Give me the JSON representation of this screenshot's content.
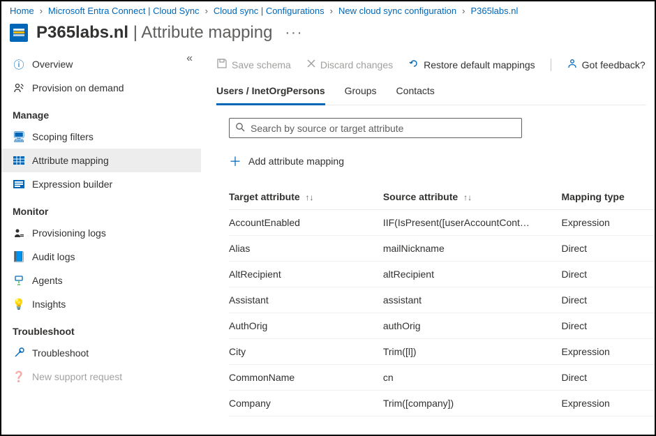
{
  "breadcrumb": [
    "Home",
    "Microsoft Entra Connect | Cloud Sync",
    "Cloud sync | Configurations",
    "New cloud sync configuration",
    "P365labs.nl"
  ],
  "header": {
    "title_main": "P365labs.nl",
    "title_sub": "Attribute mapping"
  },
  "sidebar": {
    "top": [
      {
        "label": "Overview",
        "glyph": "ⓘ"
      },
      {
        "label": "Provision on demand",
        "glyph": "👤"
      }
    ],
    "groups": [
      {
        "title": "Manage",
        "items": [
          {
            "label": "Scoping filters",
            "glyph": "🖥"
          },
          {
            "label": "Attribute mapping",
            "glyph": "▦",
            "active": true
          },
          {
            "label": "Expression builder",
            "glyph": "≡"
          }
        ]
      },
      {
        "title": "Monitor",
        "items": [
          {
            "label": "Provisioning logs",
            "glyph": "👤"
          },
          {
            "label": "Audit logs",
            "glyph": "📘"
          },
          {
            "label": "Agents",
            "glyph": "⬇"
          },
          {
            "label": "Insights",
            "glyph": "💡"
          }
        ]
      },
      {
        "title": "Troubleshoot",
        "items": [
          {
            "label": "Troubleshoot",
            "glyph": "✖"
          },
          {
            "label": "New support request",
            "glyph": "◌"
          }
        ]
      }
    ]
  },
  "toolbar": {
    "save": "Save schema",
    "discard": "Discard changes",
    "restore": "Restore default mappings",
    "feedback": "Got feedback?"
  },
  "tabs": [
    {
      "label": "Users / InetOrgPersons",
      "active": true
    },
    {
      "label": "Groups"
    },
    {
      "label": "Contacts"
    }
  ],
  "search": {
    "placeholder": "Search by source or target attribute"
  },
  "add_label": "Add attribute mapping",
  "columns": {
    "target": "Target attribute",
    "source": "Source attribute",
    "type": "Mapping type"
  },
  "rows": [
    {
      "target": "AccountEnabled",
      "source": "IIF(IsPresent([userAccountCont…",
      "type": "Expression"
    },
    {
      "target": "Alias",
      "source": "mailNickname",
      "type": "Direct"
    },
    {
      "target": "AltRecipient",
      "source": "altRecipient",
      "type": "Direct"
    },
    {
      "target": "Assistant",
      "source": "assistant",
      "type": "Direct"
    },
    {
      "target": "AuthOrig",
      "source": "authOrig",
      "type": "Direct"
    },
    {
      "target": "City",
      "source": "Trim([l])",
      "type": "Expression"
    },
    {
      "target": "CommonName",
      "source": "cn",
      "type": "Direct"
    },
    {
      "target": "Company",
      "source": "Trim([company])",
      "type": "Expression"
    }
  ]
}
